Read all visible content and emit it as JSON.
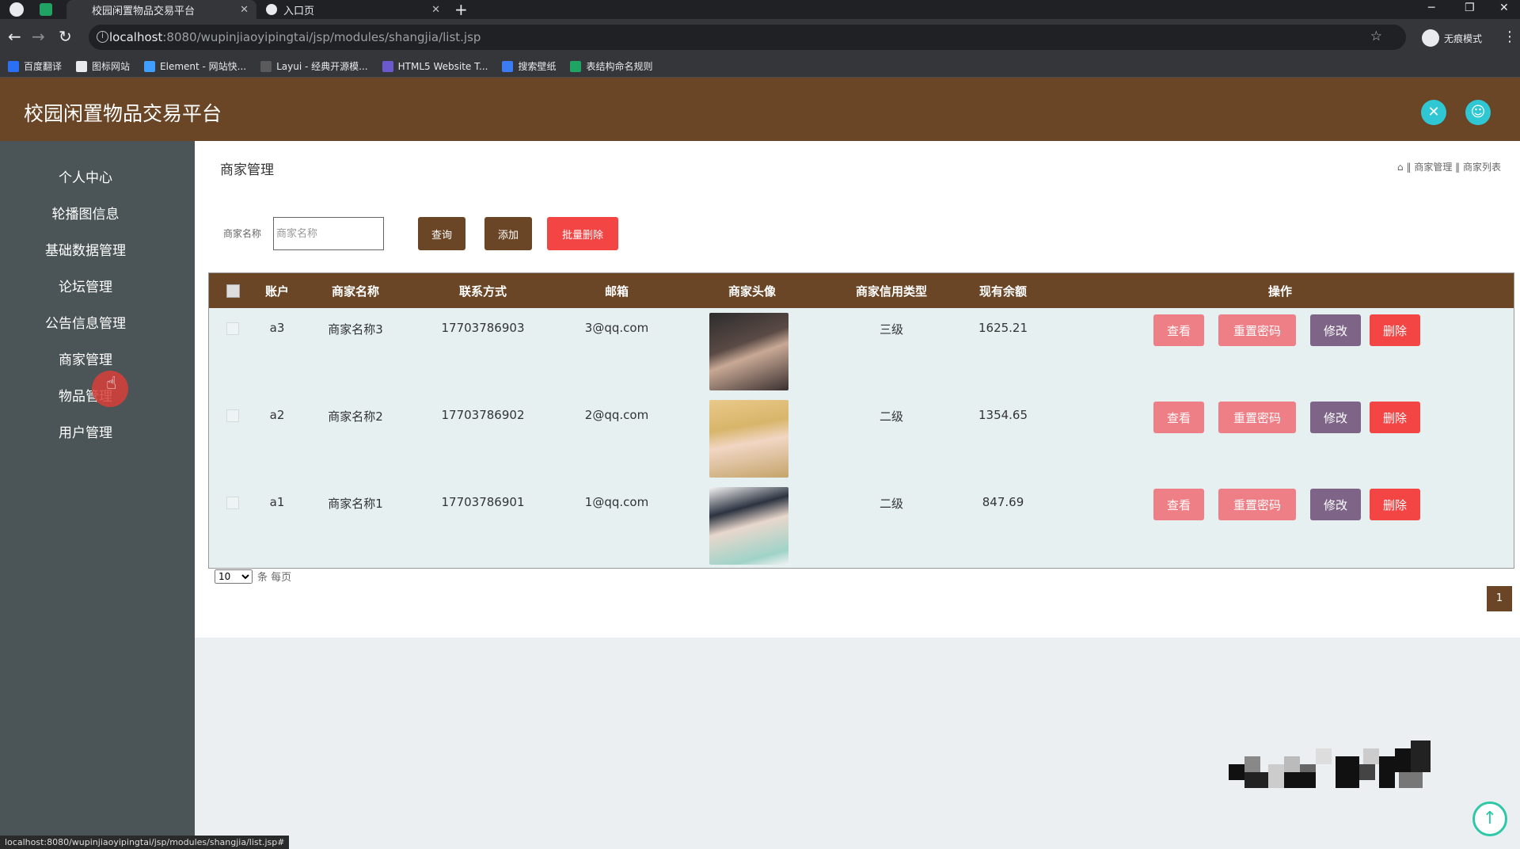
{
  "browser": {
    "tabs": [
      {
        "title": "校园闲置物品交易平台",
        "active": true
      },
      {
        "title": "入口页",
        "active": false
      }
    ],
    "url_host": "localhost",
    "url_path": ":8080/wupinjiaoyipingtai/jsp/modules/shangjia/list.jsp",
    "incognito_label": "无痕模式",
    "bookmarks": [
      "百度翻译",
      "图标网站",
      "Element - 网站快...",
      "Layui - 经典开源模...",
      "HTML5 Website T...",
      "搜索壁纸",
      "表结构命名规则"
    ],
    "status_url": "localhost:8080/wupinjiaoyipingtai/jsp/modules/shangjia/list.jsp#"
  },
  "app": {
    "title": "校园闲置物品交易平台",
    "sidebar": [
      "个人中心",
      "轮播图信息",
      "基础数据管理",
      "论坛管理",
      "公告信息管理",
      "商家管理",
      "物品管理",
      "用户管理"
    ],
    "page_title": "商家管理",
    "breadcrumb": "‖ 商家管理 ‖ 商家列表",
    "search": {
      "label": "商家名称",
      "placeholder": "商家名称"
    },
    "buttons": {
      "query": "查询",
      "add": "添加",
      "batch_delete": "批量删除"
    },
    "table": {
      "headers": [
        "账户",
        "商家名称",
        "联系方式",
        "邮箱",
        "商家头像",
        "商家信用类型",
        "现有余额",
        "操作"
      ],
      "actions": [
        "查看",
        "重置密码",
        "修改",
        "删除"
      ],
      "rows": [
        {
          "account": "a3",
          "name": "商家名称3",
          "phone": "17703786903",
          "email": "3@qq.com",
          "credit": "三级",
          "balance": "1625.21"
        },
        {
          "account": "a2",
          "name": "商家名称2",
          "phone": "17703786902",
          "email": "2@qq.com",
          "credit": "二级",
          "balance": "1354.65"
        },
        {
          "account": "a1",
          "name": "商家名称1",
          "phone": "17703786901",
          "email": "1@qq.com",
          "credit": "二级",
          "balance": "847.69"
        }
      ]
    },
    "pagination": {
      "page_size": "10",
      "page_size_suffix": "条 每页",
      "current_page": "1"
    }
  },
  "colors": {
    "brand": "#6b4626",
    "accent": "#2ec7d3",
    "danger": "#f44545",
    "view": "#ee7f86",
    "edit": "#7e6588"
  }
}
